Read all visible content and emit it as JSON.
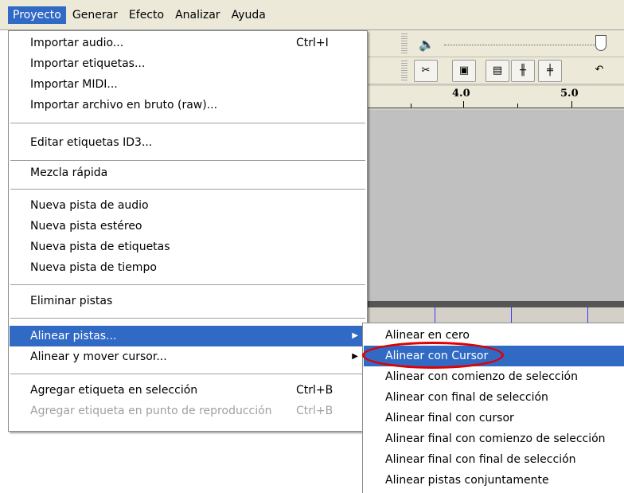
{
  "menubar": {
    "items": [
      "Proyecto",
      "Generar",
      "Efecto",
      "Analizar",
      "Ayuda"
    ],
    "active_index": 0
  },
  "toolbar": {
    "volume_icon": "speaker-icon",
    "edit_buttons": [
      "cut-icon",
      "copy-icon",
      "paste-icon",
      "trim-icon",
      "silence-icon"
    ]
  },
  "ruler": {
    "labels": [
      "4.0",
      "5.0"
    ]
  },
  "menu": {
    "items": [
      {
        "label": "Importar audio...",
        "shortcut": "Ctrl+I"
      },
      {
        "label": "Importar etiquetas...",
        "shortcut": ""
      },
      {
        "label": "Importar MIDI...",
        "shortcut": ""
      },
      {
        "label": "Importar archivo en bruto (raw)...",
        "shortcut": ""
      },
      {
        "label": "Editar etiquetas ID3...",
        "shortcut": ""
      },
      {
        "label": "Mezcla rápida",
        "shortcut": ""
      },
      {
        "label": "Nueva pista de audio",
        "shortcut": ""
      },
      {
        "label": "Nueva pista estéreo",
        "shortcut": ""
      },
      {
        "label": "Nueva pista de etiquetas",
        "shortcut": ""
      },
      {
        "label": "Nueva pista de tiempo",
        "shortcut": ""
      },
      {
        "label": "Eliminar pistas",
        "shortcut": ""
      },
      {
        "label": "Alinear pistas...",
        "shortcut": ""
      },
      {
        "label": "Alinear y mover cursor...",
        "shortcut": ""
      },
      {
        "label": "Agregar etiqueta en selección",
        "shortcut": "Ctrl+B"
      },
      {
        "label": "Agregar etiqueta en punto de reproducción",
        "shortcut": "Ctrl+B"
      }
    ]
  },
  "submenu": {
    "items": [
      "Alinear en cero",
      "Alinear con Cursor",
      "Alinear con comienzo de selección",
      "Alinear con final de selección",
      "Alinear final con cursor",
      "Alinear final con comienzo de selección",
      "Alinear final con final de selección",
      "Alinear pistas conjuntamente"
    ],
    "highlighted_index": 1
  },
  "colors": {
    "highlight": "#316ac5",
    "annotation": "#e00000",
    "menubar_bg": "#ece9d8",
    "disabled_text": "#a0a0a0"
  }
}
